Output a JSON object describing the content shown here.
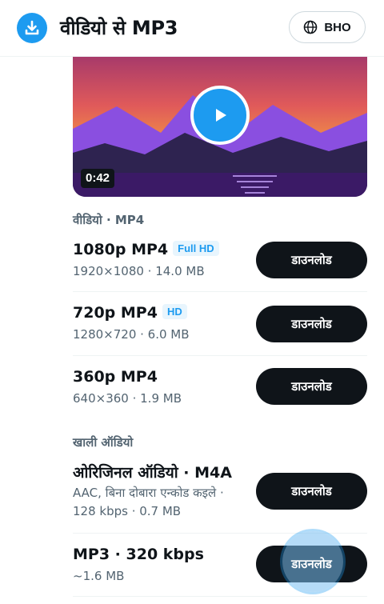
{
  "header": {
    "title": "वीडियो से MP3",
    "language_label": "BHO"
  },
  "video": {
    "duration": "0:42"
  },
  "sections": {
    "video_label": "वीडियो · MP4",
    "audio_label": "खाली ऑडियो"
  },
  "video_options": [
    {
      "title": "1080p MP4",
      "badge": "Full HD",
      "meta": "1920×1080 · 14.0 MB",
      "button": "डाउनलोड"
    },
    {
      "title": "720p MP4",
      "badge": "HD",
      "meta": "1280×720 · 6.0 MB",
      "button": "डाउनलोड"
    },
    {
      "title": "360p MP4",
      "badge": "",
      "meta": "640×360 · 1.9 MB",
      "button": "डाउनलोड"
    }
  ],
  "audio_options": [
    {
      "title": "ओरिजिनल ऑडियो · M4A",
      "meta_line1": "AAC, बिना दोबारा एन्कोड कइले ·",
      "meta_line2": "128 kbps · 0.7 MB",
      "button": "डाउनलोड"
    },
    {
      "title": "MP3 · 320 kbps",
      "meta_line1": "~1.6 MB",
      "button": "डाउनलोड"
    }
  ],
  "colors": {
    "accent": "#1d9bf0",
    "button_bg": "#0f1419",
    "muted_text": "#536471"
  }
}
